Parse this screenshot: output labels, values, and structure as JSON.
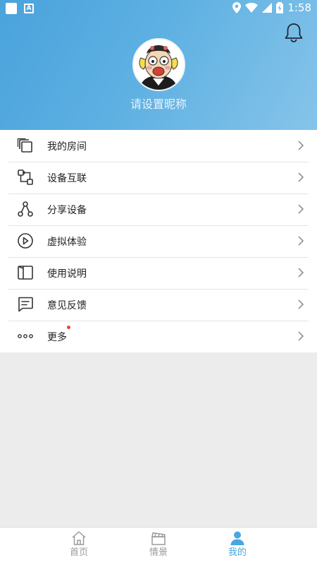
{
  "status_bar": {
    "time": "1:58"
  },
  "profile": {
    "nickname": "请设置昵称"
  },
  "menu": {
    "items": [
      {
        "label": "我的房间",
        "icon": "rooms-icon"
      },
      {
        "label": "设备互联",
        "icon": "device-link-icon"
      },
      {
        "label": "分享设备",
        "icon": "share-icon"
      },
      {
        "label": "虚拟体验",
        "icon": "play-icon"
      },
      {
        "label": "使用说明",
        "icon": "book-icon"
      },
      {
        "label": "意见反馈",
        "icon": "feedback-icon"
      },
      {
        "label": "更多",
        "icon": "more-icon",
        "badge_dot": true
      }
    ]
  },
  "tab_bar": {
    "tabs": [
      {
        "label": "首页",
        "icon": "home-icon",
        "active": false
      },
      {
        "label": "情景",
        "icon": "scene-icon",
        "active": false
      },
      {
        "label": "我的",
        "icon": "person-icon",
        "active": true
      }
    ]
  },
  "colors": {
    "accent": "#4aa6e0",
    "header_start": "#4aa3dc",
    "header_end": "#86c4ea",
    "badge": "#e8453a"
  }
}
